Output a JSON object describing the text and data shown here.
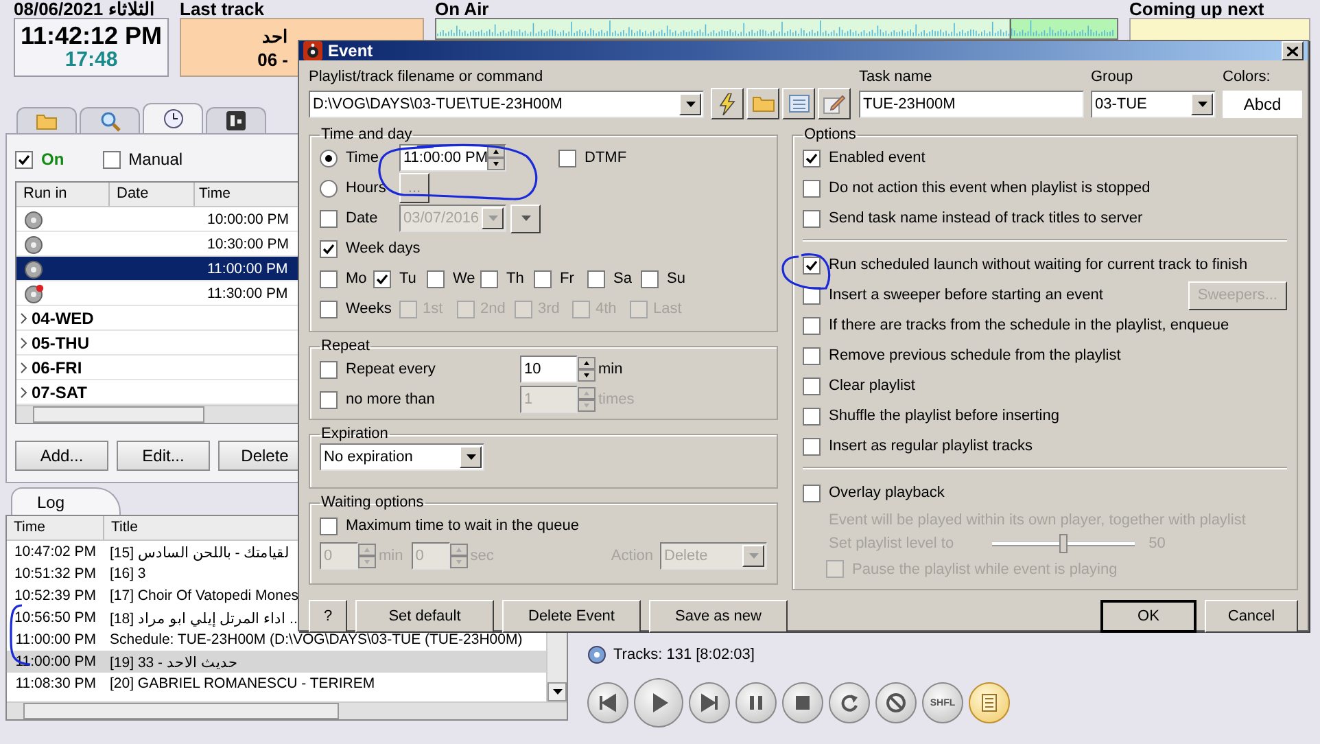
{
  "header": {
    "date": "08/06/2021",
    "weekday": "الثلاثاء",
    "clock": "11:42:12 PM",
    "countdown": "17:48",
    "last_track": {
      "title": "Last track",
      "lines": [
        "احد",
        "06 -"
      ]
    },
    "on_air": {
      "title": "On Air"
    },
    "coming_up": {
      "title": "Coming up next"
    }
  },
  "scheduler": {
    "tabs": [
      {
        "kind": "folder",
        "selected": false
      },
      {
        "kind": "search",
        "selected": false
      },
      {
        "kind": "clock",
        "selected": true
      },
      {
        "kind": "panel",
        "selected": false
      }
    ],
    "on": {
      "label": "On",
      "checked": true
    },
    "manual": {
      "label": "Manual",
      "checked": false
    },
    "columns": [
      "Run in",
      "Date",
      "Time"
    ],
    "rows": [
      {
        "kind": "event",
        "time": "10:00:00 PM",
        "selected": false,
        "flagged": false
      },
      {
        "kind": "event",
        "time": "10:30:00 PM",
        "selected": false,
        "flagged": false
      },
      {
        "kind": "event",
        "time": "11:00:00 PM",
        "selected": true,
        "flagged": false
      },
      {
        "kind": "event",
        "time": "11:30:00 PM",
        "selected": false,
        "flagged": true
      },
      {
        "kind": "group",
        "label": "04-WED"
      },
      {
        "kind": "group",
        "label": "05-THU"
      },
      {
        "kind": "group",
        "label": "06-FRI"
      },
      {
        "kind": "group",
        "label": "07-SAT"
      }
    ],
    "buttons": [
      "Add...",
      "Edit...",
      "Delete"
    ]
  },
  "log": {
    "tab": "Log",
    "columns": [
      "Time",
      "Title"
    ],
    "rows": [
      {
        "time": "10:47:02 PM",
        "title": "[15] لقيامتك - باللحن السادس",
        "selected": false
      },
      {
        "time": "10:51:32 PM",
        "title": "[16] 3",
        "selected": false
      },
      {
        "time": "10:52:39 PM",
        "title": "[17] Choir Of Vatopedi Mones",
        "selected": false
      },
      {
        "time": "10:56:50 PM",
        "title": "[18] اداء المرتل إيلي ابو مراد ..",
        "selected": false
      },
      {
        "time": "11:00:00 PM",
        "title": "Schedule: TUE-23H00M (D:\\VOG\\DAYS\\03-TUE (TUE-23H00M)",
        "selected": false
      },
      {
        "time": "11:00:00 PM",
        "title": "[19] حديث الاحد - 33",
        "selected": true
      },
      {
        "time": "11:08:30 PM",
        "title": "[20] GABRIEL ROMANESCU - TERIREM",
        "selected": false
      }
    ]
  },
  "player": {
    "tracks": "Tracks: 131 [8:02:03]",
    "buttons": [
      {
        "kind": "previous",
        "selected": false
      },
      {
        "kind": "play",
        "selected": false
      },
      {
        "kind": "next",
        "selected": false
      },
      {
        "kind": "pause",
        "selected": false
      },
      {
        "kind": "stop",
        "selected": false
      },
      {
        "kind": "repeat",
        "selected": false
      },
      {
        "kind": "cancel",
        "selected": false
      },
      {
        "kind": "text",
        "label": "SHFL",
        "selected": false
      },
      {
        "kind": "list",
        "selected": true
      }
    ]
  },
  "dialog": {
    "title": "Event",
    "command": {
      "label": "Playlist/track filename or command",
      "value": "D:\\VOG\\DAYS\\03-TUE\\TUE-23H00M"
    },
    "tools": [
      {
        "kind": "lightning"
      },
      {
        "kind": "folder"
      },
      {
        "kind": "list"
      },
      {
        "kind": "edit"
      }
    ],
    "task_name": {
      "label": "Task name",
      "value": "TUE-23H00M"
    },
    "group": {
      "label": "Group",
      "value": "03-TUE"
    },
    "colors": {
      "label": "Colors:",
      "sample": "Abcd"
    },
    "time_and_day": {
      "title": "Time and day",
      "modes": [
        {
          "label": "Time",
          "selected": true,
          "value": "11:00:00 PM"
        },
        {
          "label": "Hours",
          "selected": false,
          "button": "..."
        }
      ],
      "dtmf": {
        "label": "DTMF",
        "checked": false
      },
      "date": {
        "label": "Date",
        "checked": false,
        "value": "03/07/2016"
      },
      "week_days": {
        "label": "Week days",
        "checked": true
      },
      "days": [
        {
          "label": "Mo",
          "checked": false
        },
        {
          "label": "Tu",
          "checked": true
        },
        {
          "label": "We",
          "checked": false
        },
        {
          "label": "Th",
          "checked": false
        },
        {
          "label": "Fr",
          "checked": false
        },
        {
          "label": "Sa",
          "checked": false
        },
        {
          "label": "Su",
          "checked": false
        }
      ],
      "weeks": {
        "label": "Weeks",
        "checked": false
      },
      "week_numbers": [
        {
          "label": "1st",
          "checked": false
        },
        {
          "label": "2nd",
          "checked": false
        },
        {
          "label": "3rd",
          "checked": false
        },
        {
          "label": "4th",
          "checked": false
        },
        {
          "label": "Last",
          "checked": false
        }
      ]
    },
    "repeat": {
      "title": "Repeat",
      "every": {
        "label": "Repeat every",
        "checked": false,
        "value": "10",
        "unit": "min",
        "disabled": false
      },
      "limit": {
        "label": "no more than",
        "checked": false,
        "value": "1",
        "unit": "times",
        "disabled": true
      }
    },
    "expiration": {
      "title": "Expiration",
      "value": "No expiration"
    },
    "waiting": {
      "title": "Waiting options",
      "max_wait": {
        "label": "Maximum time to wait in the queue",
        "checked": false
      },
      "minutes": {
        "value": "0",
        "unit": "min"
      },
      "seconds": {
        "value": "0",
        "unit": "sec"
      },
      "action": {
        "label": "Action",
        "value": "Delete"
      },
      "disabled": true
    },
    "options": {
      "title": "Options",
      "groups": [
        {
          "items": [
            {
              "kind": "check",
              "label": "Enabled event",
              "checked": true
            },
            {
              "kind": "check",
              "label": "Do not action this event when playlist is stopped",
              "checked": false
            },
            {
              "kind": "check",
              "label": "Send task name instead of track titles to server",
              "checked": false
            }
          ]
        },
        {
          "items": [
            {
              "kind": "check",
              "label": "Run scheduled launch without waiting for current track to finish",
              "checked": true
            },
            {
              "kind": "check",
              "label": "Insert a sweeper before starting an event",
              "checked": false,
              "button": {
                "label": "Sweepers...",
                "disabled": true
              }
            },
            {
              "kind": "check",
              "label": "If there are tracks from the schedule in the playlist, enqueue",
              "checked": false
            },
            {
              "kind": "check",
              "label": "Remove previous schedule from the playlist",
              "checked": false
            },
            {
              "kind": "check",
              "label": "Clear playlist",
              "checked": false
            },
            {
              "kind": "check",
              "label": "Shuffle the playlist before inserting",
              "checked": false
            },
            {
              "kind": "check",
              "label": "Insert as regular playlist tracks",
              "checked": false
            }
          ]
        },
        {
          "items": [
            {
              "kind": "check",
              "label": "Overlay playback",
              "checked": false,
              "disabled": false
            },
            {
              "kind": "note",
              "label": "Event will be played within its own player, together with playlist",
              "disabled": true
            },
            {
              "kind": "slider",
              "label": "Set playlist level to",
              "level": 0.5,
              "reading": "50",
              "disabled": true
            },
            {
              "kind": "subcheck",
              "label": "Pause the playlist while event is playing",
              "checked": false,
              "disabled": true
            }
          ]
        }
      ]
    },
    "footer": {
      "left_buttons": [
        "?",
        "Set default",
        "Delete Event",
        "Save as new"
      ],
      "ok": "OK",
      "cancel": "Cancel"
    }
  }
}
